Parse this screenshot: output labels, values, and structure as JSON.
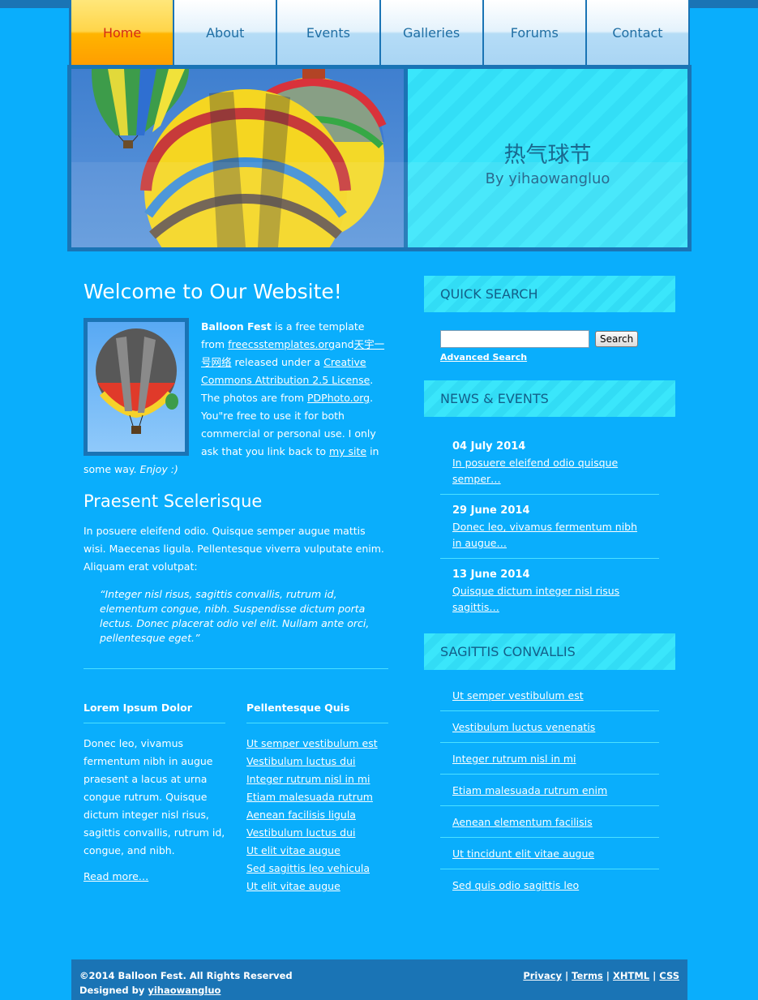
{
  "nav": {
    "items": [
      {
        "label": "Home",
        "active": true
      },
      {
        "label": "About"
      },
      {
        "label": "Events"
      },
      {
        "label": "Galleries"
      },
      {
        "label": "Forums"
      },
      {
        "label": "Contact"
      }
    ]
  },
  "header": {
    "title": "热气球节",
    "subtitle": "By yihaowangluo"
  },
  "main": {
    "welcome": "Welcome to Our Website!",
    "intro": {
      "brand": "Balloon Fest",
      "t1": " is a free template from ",
      "link1": "freecsstemplates.org",
      "and": "and",
      "link2": "天宇一号网络",
      "t2": " released under a ",
      "link3": "Creative Commons Attribution 2.5 License",
      "t3": ". The photos are from ",
      "link4": "PDPhoto.org",
      "t4": ". You\"re free to use it for both commercial or personal use. I only ask that you link back to ",
      "link5": "my site",
      "t5": " in some way. ",
      "enjoy": "Enjoy :)"
    },
    "praesent_title": "Praesent Scelerisque",
    "praesent_text": "In posuere eleifend odio. Quisque semper augue mattis wisi. Maecenas ligula. Pellentesque viverra vulputate enim. Aliquam erat volutpat:",
    "quote": "“Integer nisl risus, sagittis convallis, rutrum id, elementum congue, nibh. Suspendisse dictum porta lectus. Donec placerat odio vel elit. Nullam ante orci, pellentesque eget.”",
    "col1": {
      "title": "Lorem Ipsum Dolor",
      "text": "Donec leo, vivamus fermentum nibh in augue praesent a lacus at urna congue rutrum. Quisque dictum integer nisl risus, sagittis convallis, rutrum id, congue, and nibh.",
      "more": "Read more…"
    },
    "col2": {
      "title": "Pellentesque Quis",
      "links": [
        "Ut semper vestibulum est",
        "Vestibulum luctus dui",
        "Integer rutrum nisl in mi",
        "Etiam malesuada rutrum",
        "Aenean facilisis ligula",
        "Vestibulum luctus dui",
        "Ut elit vitae augue",
        "Sed sagittis leo vehicula",
        "Ut elit vitae augue"
      ]
    }
  },
  "sidebar": {
    "search": {
      "title": "QUICK SEARCH",
      "button": "Search",
      "advanced": "Advanced Search"
    },
    "news": {
      "title": "NEWS & EVENTS",
      "items": [
        {
          "date": "04 July 2014",
          "text": "In posuere eleifend odio quisque semper…"
        },
        {
          "date": "29 June 2014",
          "text": "Donec leo, vivamus fermentum nibh in augue…"
        },
        {
          "date": "13 June 2014",
          "text": "Quisque dictum integer nisl risus sagittis…"
        }
      ]
    },
    "sagittis": {
      "title": "SAGITTIS CONVALLIS",
      "links": [
        "Ut semper vestibulum est",
        "Vestibulum luctus venenatis",
        "Integer rutrum nisl in mi",
        "Etiam malesuada rutrum enim",
        "Aenean elementum facilisis",
        "Ut tincidunt elit vitae augue",
        "Sed quis odio sagittis leo"
      ]
    }
  },
  "footer": {
    "copyright": "©2014 Balloon Fest. All Rights Reserved",
    "designed_prefix": "Designed by ",
    "designer": "yihaowangluo",
    "links": [
      "Privacy",
      "Terms",
      "XHTML",
      "CSS"
    ],
    "separator": "|"
  },
  "colors": {
    "background": "#0aaefc",
    "dark_blue": "#1a74b5",
    "cyan_box": "#3ae6fb",
    "active_tab": "#ffb400",
    "active_tab_text": "#d52a16"
  }
}
